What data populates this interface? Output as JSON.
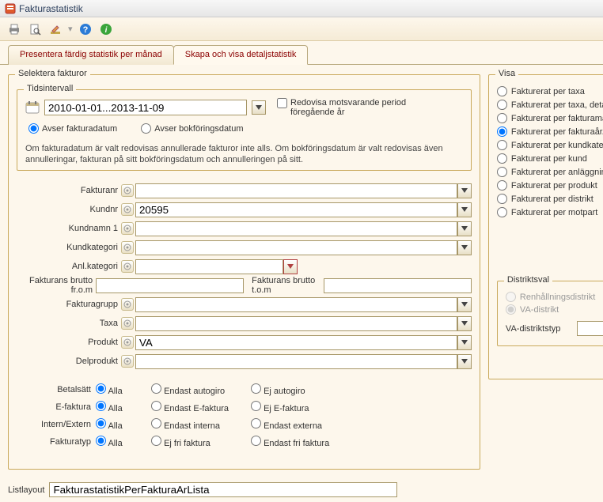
{
  "window": {
    "title": "Fakturastatistik"
  },
  "tabs": {
    "tab0": "Presentera färdig statistik per månad",
    "tab1": "Skapa och visa detaljstatistik"
  },
  "selektera": {
    "legend": "Selektera fakturor",
    "tidsintervall": {
      "legend": "Tidsintervall",
      "daterange": "2010-01-01...2013-11-09",
      "redovisa_label": "Redovisa motsvarande period föregående år",
      "avser_fakturadatum": "Avser fakturadatum",
      "avser_bokforingsdatum": "Avser bokföringsdatum",
      "note": "Om fakturadatum är valt redovisas annullerade fakturor inte alls. Om bokföringsdatum är valt redovisas även annulleringar, fakturan på sitt bokföringsdatum och annulleringen på sitt."
    },
    "fields": {
      "fakturanr": "Fakturanr",
      "kundnr": "Kundnr",
      "kundnr_value": "20595",
      "kundnamn1": "Kundnamn 1",
      "kundkategori": "Kundkategori",
      "anlkategori": "Anl.kategori",
      "fakturans_brutto_from": "Fakturans brutto fr.o.m",
      "fakturans_brutto_tom": "Fakturans brutto t.o.m",
      "fakturagrupp": "Fakturagrupp",
      "taxa": "Taxa",
      "produkt": "Produkt",
      "produkt_value": "VA",
      "delprodukt": "Delprodukt"
    },
    "radios": {
      "betalsatt": {
        "label": "Betalsätt",
        "alla": "Alla",
        "o1": "Endast autogiro",
        "o2": "Ej autogiro"
      },
      "efaktura": {
        "label": "E-faktura",
        "alla": "Alla",
        "o1": "Endast E-faktura",
        "o2": "Ej E-faktura"
      },
      "internextern": {
        "label": "Intern/Extern",
        "alla": "Alla",
        "o1": "Endast interna",
        "o2": "Endast externa"
      },
      "fakturatyp": {
        "label": "Fakturatyp",
        "alla": "Alla",
        "o1": "Ej fri faktura",
        "o2": "Endast fri faktura"
      }
    }
  },
  "visa": {
    "legend": "Visa",
    "options": {
      "o0": "Fakturerat per taxa",
      "o1": "Fakturerat per taxa, detaljer per taxed",
      "o2": "Fakturerat per fakturamånad/bokföri",
      "o3": "Fakturerat per fakturaår/bokföringså",
      "o4": "Fakturerat per kundkategori",
      "o5": "Fakturerat per kund",
      "o6": "Fakturerat per anläggningskategori",
      "o7": "Fakturerat per produkt",
      "o8": "Fakturerat per distrikt",
      "o9": "Fakturerat per motpart"
    }
  },
  "distriktsval": {
    "legend": "Distriktsval",
    "renhallning": "Renhållningsdistrikt",
    "va": "VA-distrikt",
    "vadistriktstyp": "VA-distriktstyp"
  },
  "bottom": {
    "listlayout": "Listlayout",
    "listlayout_value": "FakturastatistikPerFakturaArLista"
  }
}
